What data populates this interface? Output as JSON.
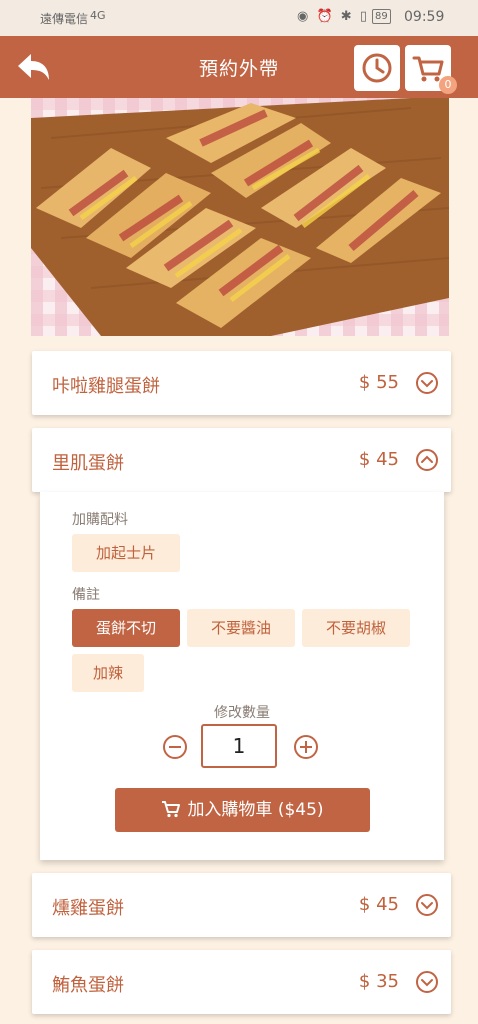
{
  "status_bar": {
    "carrier": "遠傳電信",
    "network": "4G",
    "battery": "89",
    "time": "09:59"
  },
  "header": {
    "title": "預約外帶",
    "cart_count": "0"
  },
  "icons": {
    "back": "back-arrow-icon",
    "history": "clock-icon",
    "cart": "cart-icon"
  },
  "menu": {
    "items": [
      {
        "name": "咔啦雞腿蛋餅",
        "price": "$ 55",
        "expanded": false
      },
      {
        "name": "里肌蛋餅",
        "price": "$ 45",
        "expanded": true
      },
      {
        "name": "燻雞蛋餅",
        "price": "$ 45",
        "expanded": false
      },
      {
        "name": "鮪魚蛋餅",
        "price": "$ 35",
        "expanded": false
      }
    ]
  },
  "options": {
    "addons_label": "加購配料",
    "addons": [
      "加起士片"
    ],
    "notes_label": "備註",
    "notes": [
      {
        "label": "蛋餅不切",
        "selected": true
      },
      {
        "label": "不要醬油",
        "selected": false
      },
      {
        "label": "不要胡椒",
        "selected": false
      },
      {
        "label": "加辣",
        "selected": false
      }
    ],
    "qty_label": "修改數量",
    "qty": "1",
    "add_to_cart": "加入購物車 ($45)"
  },
  "colors": {
    "primary": "#c16444",
    "chip_bg": "#fdecd9",
    "page_bg": "#fdf1e3"
  }
}
